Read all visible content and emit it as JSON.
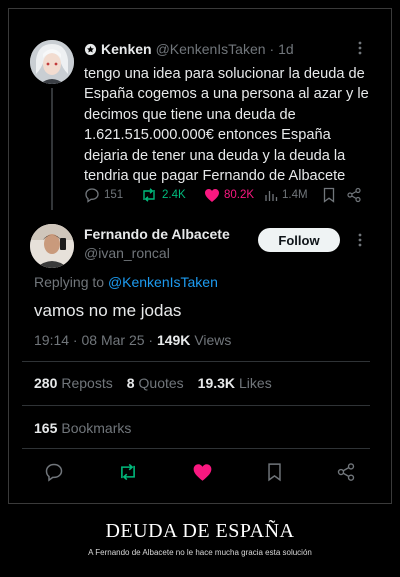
{
  "quoted_tweet": {
    "author_name": "Kenken",
    "handle": "@KenkenIsTaken",
    "time": "· 1d",
    "text": "tengo una idea para solucionar la deuda de España cogemos a una persona al azar y le decimos que tiene una deuda de 1.621.515.000.000€ entonces España dejaria de tener una deuda y la deuda la tendria que pagar Fernando de Albacete",
    "replies": "151",
    "reposts": "2.4K",
    "likes": "80.2K",
    "views": "1.4M",
    "colors": {
      "repost": "#00ba7c",
      "like": "#f91880",
      "muted": "#71767b"
    }
  },
  "main_tweet": {
    "author_name": "Fernando de Albacete",
    "handle": "@ivan_roncal",
    "follow_label": "Follow",
    "replying_prefix": "Replying to",
    "replying_handle": "@KenkenIsTaken",
    "text": "vamos no me jodas",
    "timestamp": "19:14 · 08 Mar 25 ·",
    "views_count": "149K",
    "views_label": "Views",
    "reposts_count": "280",
    "reposts_label": "Reposts",
    "quotes_count": "8",
    "quotes_label": "Quotes",
    "likes_count": "19.3K",
    "likes_label": "Likes",
    "bookmarks_count": "165",
    "bookmarks_label": "Bookmarks",
    "colors": {
      "accent": "#1d9bf0",
      "repost": "#00ba7c",
      "like": "#f91880"
    }
  },
  "caption": {
    "title": "DEUDA DE ESPAÑA",
    "subtitle": "A Fernando de Albacete no le hace mucha gracia esta solución"
  },
  "icons": [
    "verified-badge-icon",
    "more-icon",
    "reply-icon",
    "repost-icon",
    "like-icon",
    "views-icon",
    "bookmark-icon",
    "share-icon"
  ]
}
